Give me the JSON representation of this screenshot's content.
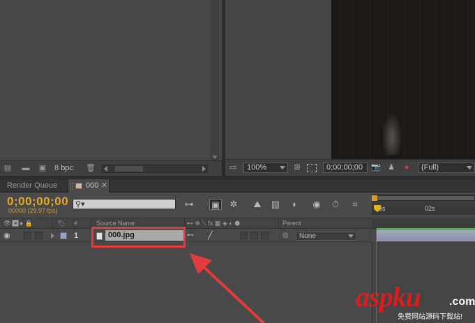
{
  "project_panel": {
    "bit_depth": "8 bpc",
    "icons": [
      "interpret-footage-icon",
      "folder-icon",
      "new-composition-icon",
      "trash-icon"
    ]
  },
  "viewer": {
    "zoom": "100%",
    "timecode": "0;00;00;00",
    "resolution": "(Full)"
  },
  "tabs": {
    "render_queue": "Render Queue",
    "composition": "000"
  },
  "timeline": {
    "timecode": "0;00;00;00",
    "frame_info": "00000 (29.97 fps)",
    "search_placeholder": "",
    "ruler": {
      "tick_00": "0s",
      "tick_02": "02s"
    },
    "columns": {
      "number": "#",
      "source_name": "Source Name",
      "parent": "Parent"
    },
    "layers": [
      {
        "number": "1",
        "name": "000.jpg",
        "parent": "None",
        "label_color": "#9aa3c8"
      }
    ]
  },
  "watermark": {
    "logo": "aspku",
    "domain": ".com",
    "subtitle": "免费网站源码下载站!"
  },
  "colors": {
    "timecode": "#e3a623",
    "annotation": "#e23b3b",
    "playhead": "#e7b11a"
  }
}
